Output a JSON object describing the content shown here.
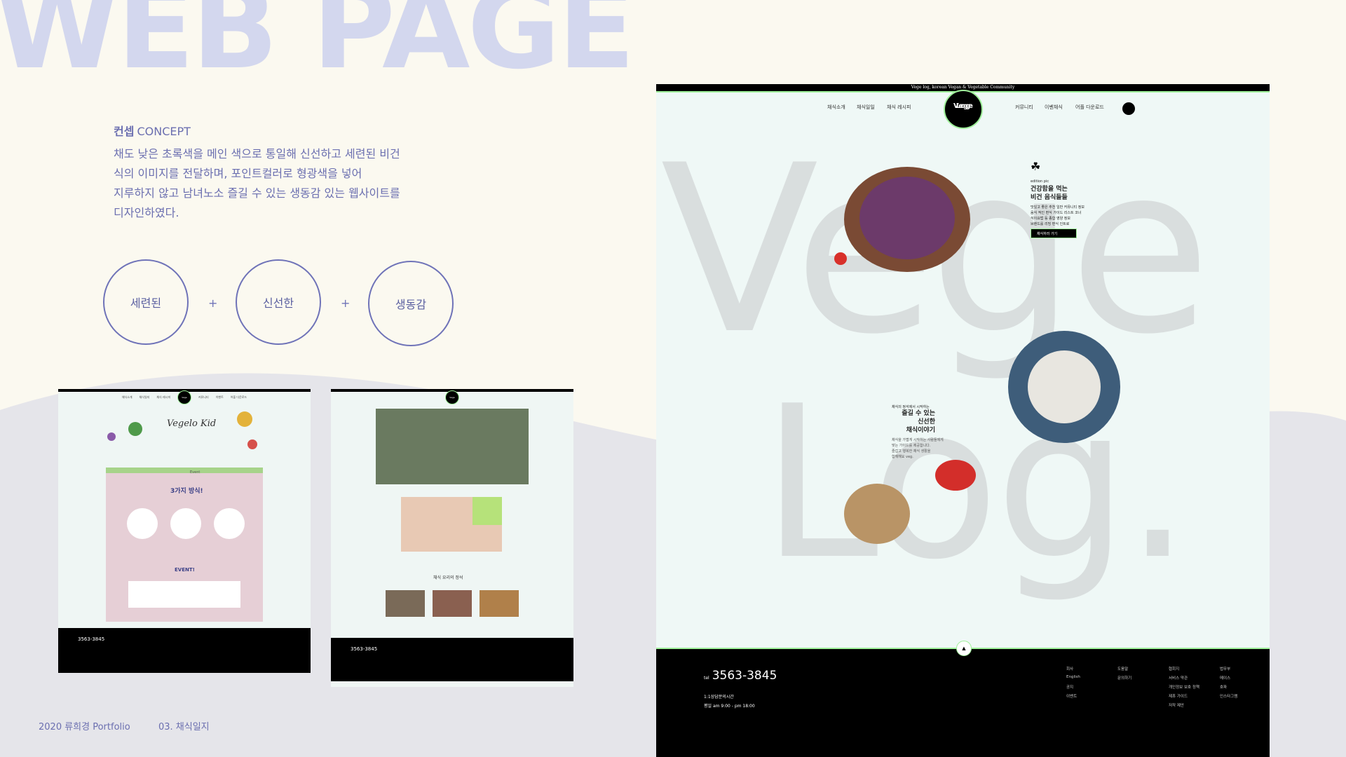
{
  "page": {
    "big_title": "WEB PAGE"
  },
  "concept": {
    "heading_ko": "컨셉",
    "heading_en": "CONCEPT",
    "body": "채도 낮은 초록색을 메인 색으로 통일해 신선하고 세련된 비건\n 식의 이미지를 전달하며, 포인트컬러로 형광색을 넣어\n 지루하지 않고 남녀노소 즐길 수 있는 생동감 있는 웹사이트를\n 디자인하였다."
  },
  "keywords": [
    "세련된",
    "신선한",
    "생동감"
  ],
  "plus": "+",
  "footer": {
    "portfolio": "2020 류희경 Portfolio",
    "section": "03. 채식일지"
  },
  "colors": {
    "background": "#fbf9f0",
    "accent": "#6f73b8",
    "neon": "#9ff09a",
    "site_bg": "#eff8f6"
  },
  "thumb1": {
    "nav": [
      "채식소개",
      "채식일지",
      "채식 레시피",
      "커뮤니티",
      "이벤트",
      "어플 다운로드"
    ],
    "logo": [
      "Vege",
      "Log"
    ],
    "hero_title": "Vegelo Kid",
    "card_tag": "Event",
    "card_title": "3가지 방식!",
    "event_title": "EVENT!",
    "tel": "3563-3845"
  },
  "thumb2": {
    "logo": [
      "Vege",
      "Log"
    ],
    "section_title": "채식 요리의 정석",
    "tel": "3563-3845"
  },
  "main": {
    "topbar": "Vege log, korean Vegan & Vegetable Community",
    "nav_left": [
      "채식소개",
      "채식일일",
      "채식 레시피"
    ],
    "nav_right": [
      "커뮤니티",
      "이벤채식",
      "어플 다운로드"
    ],
    "logo": [
      "Vege",
      "Log"
    ],
    "bg_word_1": "Vege",
    "bg_word_2": "Log.",
    "promo_small": "edition pic",
    "promo_title": "건강함을 먹는\n비건 음식들들",
    "promo_body": "맛있고 좋은 추천 일반 커뮤니티 정보\n음식 적인 편식 가이드 리스트 코너\n식이요법 등 종합 영양 정보\n브랜드를 리빙 편식 인트로",
    "promo_button": "채식하러 가기",
    "story_small": "채식의 정석에서 시작하는",
    "story_title": "즐길 수 있는\n신선한\n채식이야기",
    "story_body": "채식을 가볍게 시작하는 사람들에게\n맞는 가이드를 제공합니다.\n즐겁고 행복한 채식 생활을\n함께해요 veg.",
    "tel_label": "tel",
    "tel": "3563-3845",
    "info": [
      "1:1상담문의시간",
      "평일 am 9:00 - pm 18:00"
    ],
    "top_button": "▲",
    "footer_links": [
      "회사",
      "도움말",
      "협회지",
      "법무부",
      "English",
      "문의하기",
      "서비스 약관",
      "메이스",
      "공지",
      "",
      "개인정보 보호 정책",
      "호파",
      "이벤트",
      "",
      "제휴 가이드",
      "인스타그램",
      "",
      "",
      "저작 제안",
      ""
    ]
  }
}
